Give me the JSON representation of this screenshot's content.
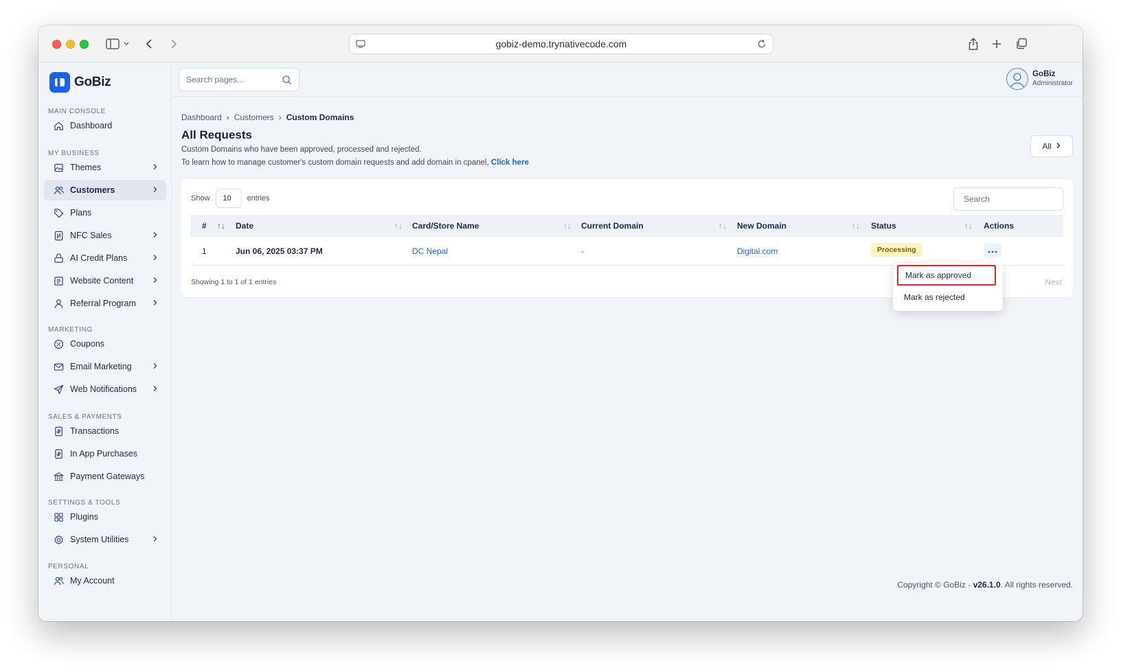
{
  "browser": {
    "url": "gobiz-demo.trynativecode.com"
  },
  "brand": {
    "name": "GoBiz",
    "accent": "#1a64e8"
  },
  "sidebar": {
    "sections": [
      {
        "label": "MAIN CONSOLE"
      },
      {
        "label": "MY BUSINESS"
      },
      {
        "label": "MARKETING"
      },
      {
        "label": "SALES & PAYMENTS"
      },
      {
        "label": "SETTINGS & TOOLS"
      },
      {
        "label": "PERSONAL"
      }
    ],
    "items": [
      {
        "label": "Dashboard",
        "icon": "home-icon"
      },
      {
        "label": "Themes",
        "icon": "image-icon"
      },
      {
        "label": "Customers",
        "icon": "users-icon"
      },
      {
        "label": "Plans",
        "icon": "tag-icon"
      },
      {
        "label": "NFC Sales",
        "icon": "nfc-card-icon"
      },
      {
        "label": "AI Credit Plans",
        "icon": "ai-credit-icon"
      },
      {
        "label": "Website Content",
        "icon": "document-icon"
      },
      {
        "label": "Referral Program",
        "icon": "user-icon"
      },
      {
        "label": "Coupons",
        "icon": "percent-icon"
      },
      {
        "label": "Email Marketing",
        "icon": "mail-icon"
      },
      {
        "label": "Web Notifications",
        "icon": "send-icon"
      },
      {
        "label": "Transactions",
        "icon": "receipt-icon"
      },
      {
        "label": "In App Purchases",
        "icon": "receipt-icon"
      },
      {
        "label": "Payment Gateways",
        "icon": "bank-icon"
      },
      {
        "label": "Plugins",
        "icon": "grid-icon"
      },
      {
        "label": "System Utilities",
        "icon": "gear-icon"
      },
      {
        "label": "My Account",
        "icon": "users-icon"
      }
    ]
  },
  "topbar": {
    "search_placeholder": "Search pages...",
    "user_name": "GoBiz",
    "user_role": "Administrator"
  },
  "breadcrumb": [
    "Dashboard",
    "Customers",
    "Custom Domains"
  ],
  "page": {
    "title": "All Requests",
    "subtitle": "Custom Domains who have been approved, processed and rejected.",
    "help_text": "To learn how to manage customer's custom domain requests and add domain in cpanel,",
    "help_link": "Click here",
    "filter_label": "All"
  },
  "table": {
    "show_label": "Show",
    "entries_value": "10",
    "entries_label": "entries",
    "search_placeholder": "Search",
    "columns": [
      "#",
      "Date",
      "Card/Store Name",
      "Current Domain",
      "New Domain",
      "Status",
      "Actions"
    ],
    "rows": [
      {
        "num": "1",
        "date": "Jun 06, 2025 03:37 PM",
        "store": "DC Nepal",
        "current_domain": "-",
        "new_domain": "Digital.com",
        "status": "Processing"
      }
    ],
    "showing": "Showing 1 to 1 of 1 entries",
    "next_label": "Next"
  },
  "dropdown": {
    "items": [
      "Mark as approved",
      "Mark as rejected"
    ]
  },
  "footer": {
    "prefix": "Copyright © GoBiz - ",
    "version": "v26.1.0",
    "suffix": ". All rights reserved."
  }
}
